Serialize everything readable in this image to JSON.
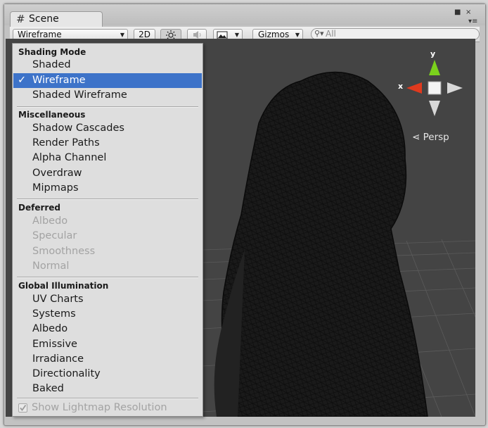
{
  "window": {
    "tab_title": "Scene",
    "tab_icon": "hash-icon"
  },
  "toolbar": {
    "draw_mode": "Wireframe",
    "btn_2d": "2D",
    "gizmos": "Gizmos",
    "search_placeholder": "All"
  },
  "scene": {
    "projection_label": "Persp",
    "axis_x": "x",
    "axis_y": "y"
  },
  "menu": {
    "sections": [
      {
        "header": "Shading Mode",
        "items": [
          {
            "label": "Shaded",
            "state": "normal"
          },
          {
            "label": "Wireframe",
            "state": "selected"
          },
          {
            "label": "Shaded Wireframe",
            "state": "normal"
          }
        ]
      },
      {
        "header": "Miscellaneous",
        "items": [
          {
            "label": "Shadow Cascades",
            "state": "normal"
          },
          {
            "label": "Render Paths",
            "state": "normal"
          },
          {
            "label": "Alpha Channel",
            "state": "normal"
          },
          {
            "label": "Overdraw",
            "state": "normal"
          },
          {
            "label": "Mipmaps",
            "state": "normal"
          }
        ]
      },
      {
        "header": "Deferred",
        "items": [
          {
            "label": "Albedo",
            "state": "disabled"
          },
          {
            "label": "Specular",
            "state": "disabled"
          },
          {
            "label": "Smoothness",
            "state": "disabled"
          },
          {
            "label": "Normal",
            "state": "disabled"
          }
        ]
      },
      {
        "header": "Global Illumination",
        "items": [
          {
            "label": "UV Charts",
            "state": "normal"
          },
          {
            "label": "Systems",
            "state": "normal"
          },
          {
            "label": "Albedo",
            "state": "normal"
          },
          {
            "label": "Emissive",
            "state": "normal"
          },
          {
            "label": "Irradiance",
            "state": "normal"
          },
          {
            "label": "Directionality",
            "state": "normal"
          },
          {
            "label": "Baked",
            "state": "normal"
          }
        ]
      }
    ],
    "checkmark": "✓",
    "lightmap_option": "Show Lightmap Resolution",
    "lightmap_checked": true
  },
  "colors": {
    "selection": "#3d73c9",
    "scene_bg": "#444444",
    "gizmo_x": "#e03a1e",
    "gizmo_y": "#7bd21c"
  }
}
